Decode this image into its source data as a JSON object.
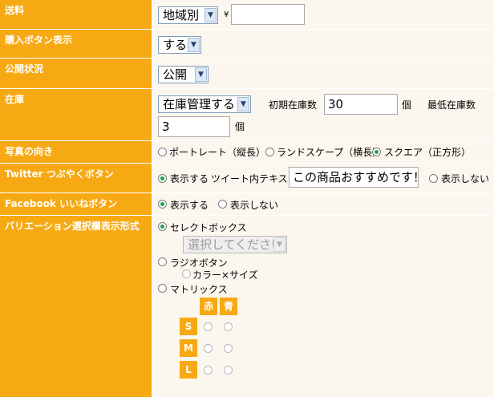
{
  "rows": {
    "shipping": {
      "label": "送料",
      "select": "地域別",
      "yen": "¥",
      "amount": ""
    },
    "buy_button": {
      "label": "購入ボタン表示",
      "select": "する"
    },
    "publish": {
      "label": "公開状況",
      "select": "公開"
    },
    "stock": {
      "label": "在庫",
      "select": "在庫管理する",
      "initial_label": "初期在庫数",
      "initial_value": "30",
      "unit1": "個",
      "min_label": "最低在庫数",
      "min_value": "3",
      "unit2": "個"
    },
    "photo": {
      "label": "写真の向き",
      "options": [
        "ポートレート（縦長）",
        "ランドスケープ（横長）",
        "スクエア（正方形）"
      ],
      "selected": 2
    },
    "twitter": {
      "label": "Twitter つぶやくボタン",
      "show": "表示する",
      "tweet_label": "ツイート内テキスト",
      "tweet_text": "この商品おすすめです！",
      "hide": "表示しない"
    },
    "facebook": {
      "label": "Facebook いいねボタン",
      "show": "表示する",
      "hide": "表示しない"
    },
    "variation": {
      "label": "バリエーション選択欄表示形式",
      "selectbox": "セレクトボックス",
      "select_placeholder": "選択してください",
      "radio": "ラジオボタン",
      "radio_sub": "カラー×サイズ",
      "matrix": "マトリックス",
      "matrix_cols": [
        "赤",
        "青"
      ],
      "matrix_rows": [
        "S",
        "M",
        "L"
      ]
    }
  },
  "colors": {
    "label_bg": "#f7a914",
    "value_bg": "#fbf7ef",
    "radio_on": "#22a04a"
  }
}
